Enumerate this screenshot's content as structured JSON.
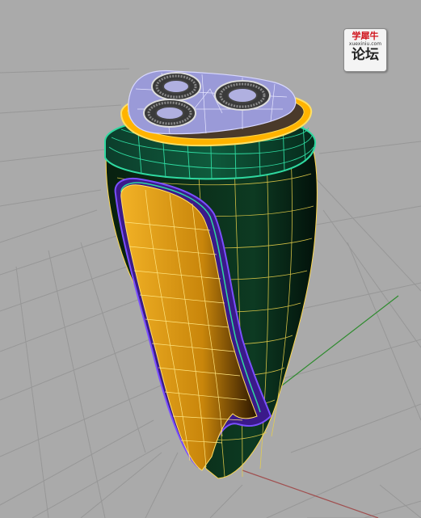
{
  "watermark": {
    "line1": "学犀牛",
    "line2": "xuexiniu.com",
    "line3": "论坛"
  },
  "viewport": {
    "background": "#aaaaaa",
    "grid_color": "#959595",
    "x_axis_color": "#a05050",
    "y_axis_color": "#2e8b2e"
  },
  "model": {
    "body_color": "#0b2a1c",
    "wire_color": "#ffd84d",
    "side_panel_color": "#e8a510",
    "collar_color": "#2fd9a0",
    "head_color": "#9a9ad8",
    "ring_color": "#ffb300",
    "blade_color": "#555555"
  }
}
